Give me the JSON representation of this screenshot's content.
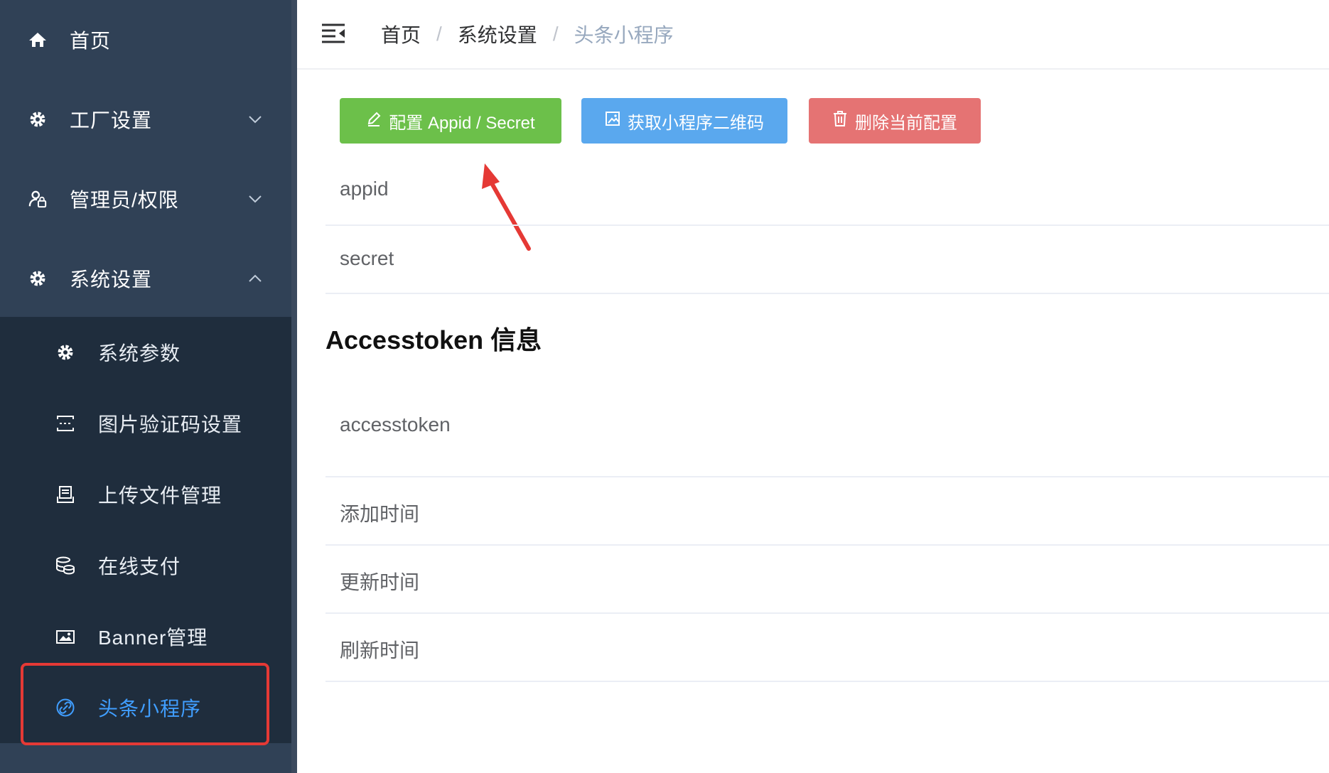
{
  "sidebar": {
    "items": [
      {
        "label": "首页",
        "icon": "home-icon"
      },
      {
        "label": "工厂设置",
        "icon": "gear-icon"
      },
      {
        "label": "管理员/权限",
        "icon": "user-lock-icon"
      },
      {
        "label": "系统设置",
        "icon": "gear-icon"
      }
    ],
    "submenu": [
      {
        "label": "系统参数",
        "icon": "gear-icon"
      },
      {
        "label": "图片验证码设置",
        "icon": "captcha-icon"
      },
      {
        "label": "上传文件管理",
        "icon": "file-icon"
      },
      {
        "label": "在线支付",
        "icon": "coins-icon"
      },
      {
        "label": "Banner管理",
        "icon": "image-icon"
      },
      {
        "label": "头条小程序",
        "icon": "link-icon"
      }
    ],
    "active_color": "#409eff",
    "bg_color": "#304156"
  },
  "header": {
    "breadcrumb": [
      "首页",
      "系统设置",
      "头条小程序"
    ],
    "separator": "/"
  },
  "toolbar": {
    "config_label": "配置 Appid / Secret",
    "qrcode_label": "获取小程序二维码",
    "delete_label": "删除当前配置"
  },
  "fields": {
    "appid": "appid",
    "secret": "secret",
    "section_title": "Accesstoken 信息",
    "accesstoken": "accesstoken",
    "add_time": "添加时间",
    "update_time": "更新时间",
    "refresh_time": "刷新时间"
  },
  "colors": {
    "green": "#6cc04a",
    "blue": "#5aa8ee",
    "red": "#e57373",
    "annotation": "#e53935"
  }
}
